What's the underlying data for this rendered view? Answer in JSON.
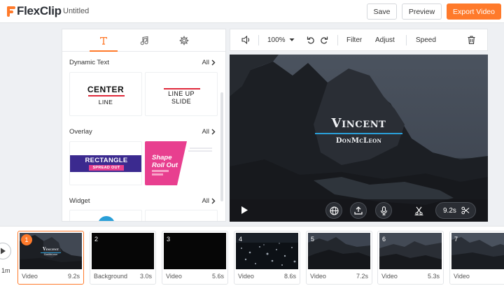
{
  "app": {
    "logo_text": "FlexClip",
    "doc_title": "Untitled"
  },
  "header": {
    "save_label": "Save",
    "preview_label": "Preview",
    "export_label": "Export Video"
  },
  "colors": {
    "accent": "#ff7a2b",
    "title_underline": "#2a9fd8",
    "text_red": "#e0293a",
    "overlay_purple": "#3b2a8f",
    "overlay_pink": "#e83f8f"
  },
  "panel": {
    "tabs": [
      {
        "name": "text",
        "icon": "text-t-icon",
        "active": true
      },
      {
        "name": "music",
        "icon": "music-note-icon",
        "active": false
      },
      {
        "name": "widget",
        "icon": "gear-icon",
        "active": false
      }
    ],
    "sections": [
      {
        "title": "Dynamic Text",
        "all_label": "All"
      },
      {
        "title": "Overlay",
        "all_label": "All"
      },
      {
        "title": "Widget",
        "all_label": "All"
      }
    ],
    "dynamic_text": {
      "center": {
        "line1": "CENTER",
        "line2": "LINE"
      },
      "lineup": {
        "line1": "LINE UP",
        "line2": "SLIDE"
      }
    },
    "overlay": {
      "rectangle": {
        "title": "RECTANGLE",
        "tag": "SPREAD OUT"
      },
      "shape": {
        "line1": "Shape",
        "line2": "Roll Out"
      }
    }
  },
  "toolbar": {
    "zoom": "100%",
    "filter_label": "Filter",
    "adjust_label": "Adjust",
    "speed_label": "Speed"
  },
  "preview": {
    "title": "Vincent",
    "subtitle": "DonMcLeon",
    "duration": "9.2s"
  },
  "timeline": {
    "scale_label": "1m",
    "clips": [
      {
        "number": "1",
        "type": "Video",
        "duration": "9.2s",
        "active": true,
        "thumb": "rocks-title"
      },
      {
        "number": "2",
        "type": "Background",
        "duration": "3.0s",
        "active": false,
        "thumb": "black"
      },
      {
        "number": "3",
        "type": "Video",
        "duration": "5.6s",
        "active": false,
        "thumb": "black"
      },
      {
        "number": "4",
        "type": "Video",
        "duration": "8.6s",
        "active": false,
        "thumb": "sparkle-water"
      },
      {
        "number": "5",
        "type": "Video",
        "duration": "7.2s",
        "active": false,
        "thumb": "rocks"
      },
      {
        "number": "6",
        "type": "Video",
        "duration": "5.3s",
        "active": false,
        "thumb": "rocks"
      },
      {
        "number": "7",
        "type": "Video",
        "duration": "",
        "active": false,
        "thumb": "coast"
      }
    ]
  }
}
